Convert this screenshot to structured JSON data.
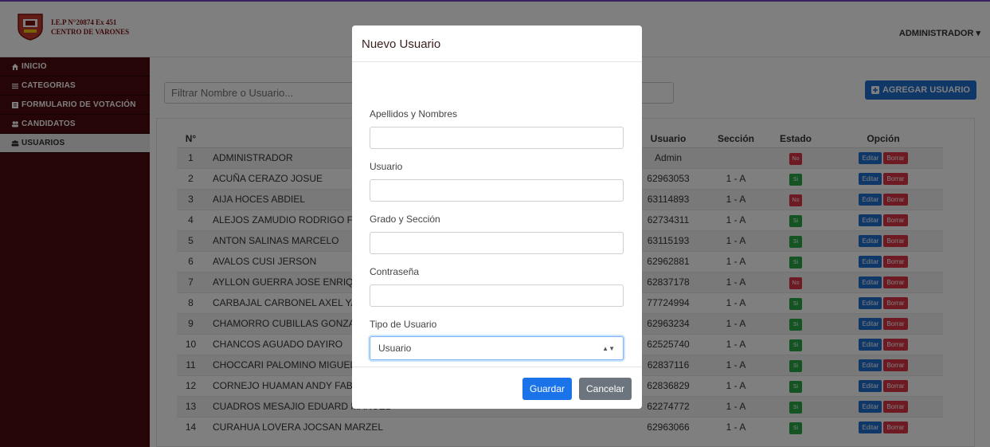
{
  "brand": {
    "line1": "I.E.P N°20874 Ex 451",
    "line2": "CENTRO DE VARONES",
    "logo_icon": "school-crest-icon"
  },
  "header": {
    "user_menu": "ADMINISTRADOR ▾"
  },
  "sidebar": {
    "items": [
      {
        "label": "INICIO",
        "icon": "home-icon"
      },
      {
        "label": "CATEGORIAS",
        "icon": "list-icon"
      },
      {
        "label": "FORMULARIO DE VOTACIÓN",
        "icon": "form-icon"
      },
      {
        "label": "CANDIDATOS",
        "icon": "group-icon"
      },
      {
        "label": "USUARIOS",
        "icon": "users-icon",
        "active": true
      }
    ]
  },
  "search": {
    "placeholder": "Filtrar Nombre o Usuario..."
  },
  "toolbar": {
    "add_label": "AGREGAR USUARIO"
  },
  "table": {
    "headers": [
      "N°",
      "",
      "Usuario",
      "Sección",
      "Estado",
      "Opción"
    ],
    "edit_label": "Editar",
    "delete_label": "Borrar",
    "rows": [
      {
        "n": "1",
        "name": "ADMINISTRADOR",
        "user": "Admin",
        "section": "",
        "status": "No"
      },
      {
        "n": "2",
        "name": "ACUÑA CERAZO JOSUE",
        "user": "62963053",
        "section": "1 - A",
        "status": "Si"
      },
      {
        "n": "3",
        "name": "AIJA HOCES ABDIEL",
        "user": "63114893",
        "section": "1 - A",
        "status": "No"
      },
      {
        "n": "4",
        "name": "ALEJOS ZAMUDIO RODRIGO FABI",
        "user": "62734311",
        "section": "1 - A",
        "status": "Si"
      },
      {
        "n": "5",
        "name": "ANTON SALINAS MARCELO",
        "user": "63115193",
        "section": "1 - A",
        "status": "Si"
      },
      {
        "n": "6",
        "name": "AVALOS CUSI JERSON",
        "user": "62962881",
        "section": "1 - A",
        "status": "Si"
      },
      {
        "n": "7",
        "name": "AYLLON GUERRA JOSE ENRIQUE",
        "user": "62837178",
        "section": "1 - A",
        "status": "No"
      },
      {
        "n": "8",
        "name": "CARBAJAL CARBONEL AXEL YAEL",
        "user": "77724994",
        "section": "1 - A",
        "status": "Si"
      },
      {
        "n": "9",
        "name": "CHAMORRO CUBILLAS GONZALO",
        "user": "62963234",
        "section": "1 - A",
        "status": "Si"
      },
      {
        "n": "10",
        "name": "CHANCOS AGUADO DAYIRO",
        "user": "62525740",
        "section": "1 - A",
        "status": "Si"
      },
      {
        "n": "11",
        "name": "CHOCCARI PALOMINO MIGUEL G",
        "user": "62837116",
        "section": "1 - A",
        "status": "Si"
      },
      {
        "n": "12",
        "name": "CORNEJO HUAMAN ANDY FABRIC",
        "user": "62836829",
        "section": "1 - A",
        "status": "Si"
      },
      {
        "n": "13",
        "name": "CUADROS MESAJIO EDUARD MANUEL",
        "user": "62274772",
        "section": "1 - A",
        "status": "Si"
      },
      {
        "n": "14",
        "name": "CURAHUA LOVERA JOCSAN MARZEL",
        "user": "62963066",
        "section": "1 - A",
        "status": "Si"
      }
    ]
  },
  "modal": {
    "title": "Nuevo Usuario",
    "fields": {
      "names": "Apellidos y Nombres",
      "user": "Usuario",
      "grade": "Grado y Sección",
      "password": "Contraseña",
      "type": "Tipo de Usuario"
    },
    "type_value": "Usuario",
    "save_label": "Guardar",
    "cancel_label": "Cancelar"
  },
  "colors": {
    "sidebar_bg": "#4a0a0a",
    "primary": "#1a73e8",
    "success": "#28a745",
    "danger": "#dc3545",
    "secondary": "#6c757d"
  }
}
